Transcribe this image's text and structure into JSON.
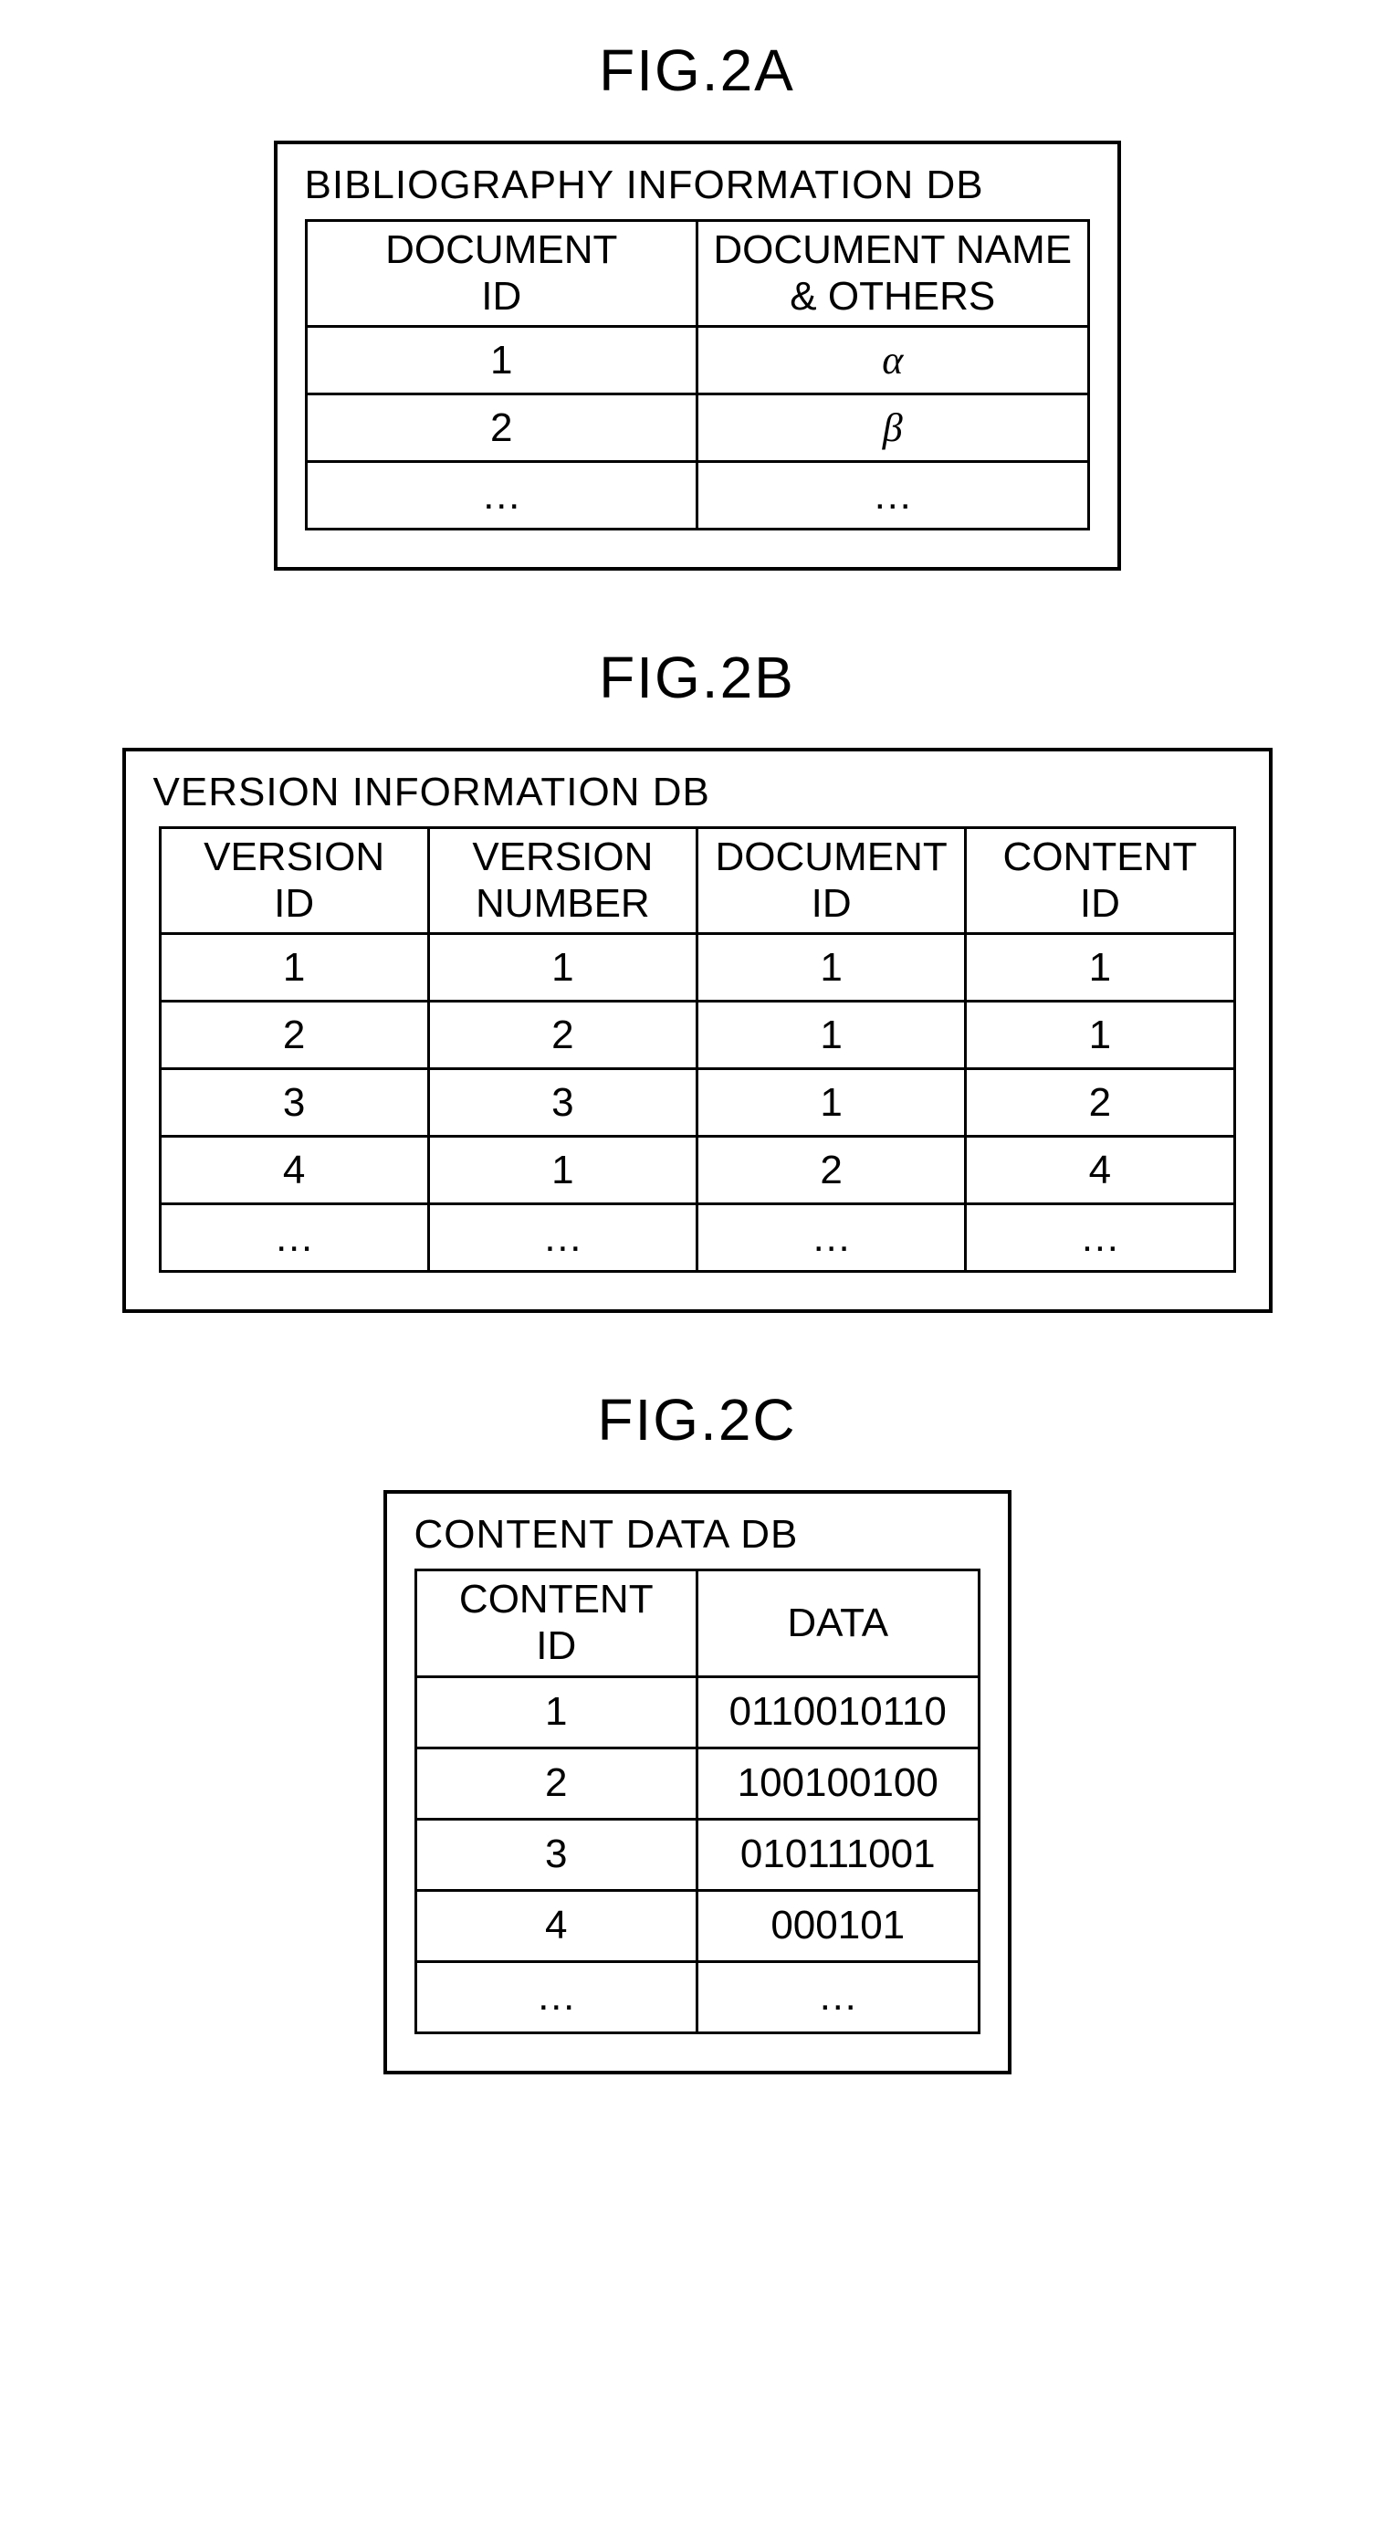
{
  "figA": {
    "label": "FIG.2A",
    "title": "BIBLIOGRAPHY INFORMATION DB",
    "headers": [
      "DOCUMENT\nID",
      "DOCUMENT NAME\n& OTHERS"
    ],
    "rows": [
      [
        "1",
        "α"
      ],
      [
        "2",
        "β"
      ],
      [
        "…",
        "…"
      ]
    ]
  },
  "figB": {
    "label": "FIG.2B",
    "title": "VERSION INFORMATION DB",
    "headers": [
      "VERSION\nID",
      "VERSION\nNUMBER",
      "DOCUMENT\nID",
      "CONTENT\nID"
    ],
    "rows": [
      [
        "1",
        "1",
        "1",
        "1"
      ],
      [
        "2",
        "2",
        "1",
        "1"
      ],
      [
        "3",
        "3",
        "1",
        "2"
      ],
      [
        "4",
        "1",
        "2",
        "4"
      ],
      [
        "…",
        "…",
        "…",
        "…"
      ]
    ]
  },
  "figC": {
    "label": "FIG.2C",
    "title": "CONTENT DATA DB",
    "headers": [
      "CONTENT\nID",
      "DATA"
    ],
    "rows": [
      [
        "1",
        "0110010110"
      ],
      [
        "2",
        "100100100"
      ],
      [
        "3",
        "010111001"
      ],
      [
        "4",
        "000101"
      ],
      [
        "…",
        "…"
      ]
    ]
  }
}
